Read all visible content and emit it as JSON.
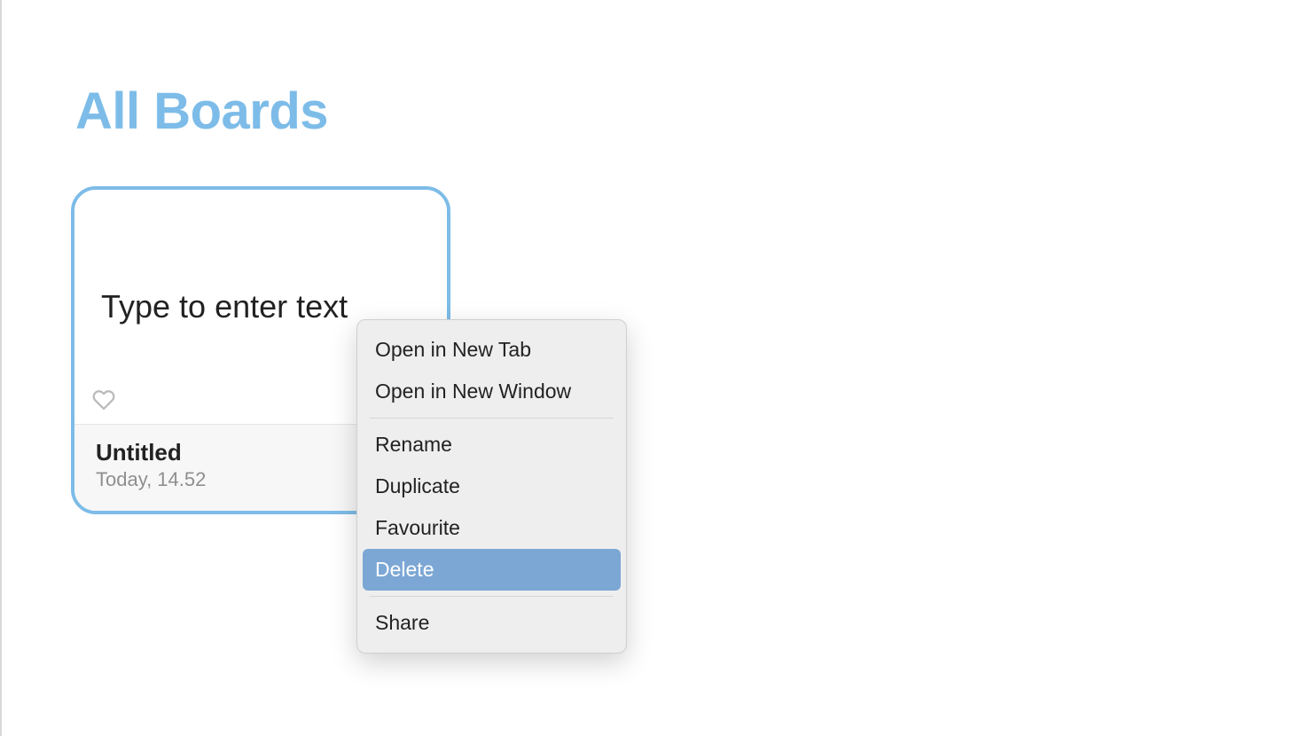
{
  "page": {
    "title": "All Boards"
  },
  "board": {
    "preview_text": "Type to enter text",
    "title": "Untitled",
    "timestamp": "Today, 14.52"
  },
  "context_menu": {
    "open_new_tab": "Open in New Tab",
    "open_new_window": "Open in New Window",
    "rename": "Rename",
    "duplicate": "Duplicate",
    "favourite": "Favourite",
    "delete": "Delete",
    "share": "Share",
    "highlighted": "delete"
  },
  "colors": {
    "accent": "#7dbce8",
    "menu_highlight": "#7ca7d4"
  }
}
